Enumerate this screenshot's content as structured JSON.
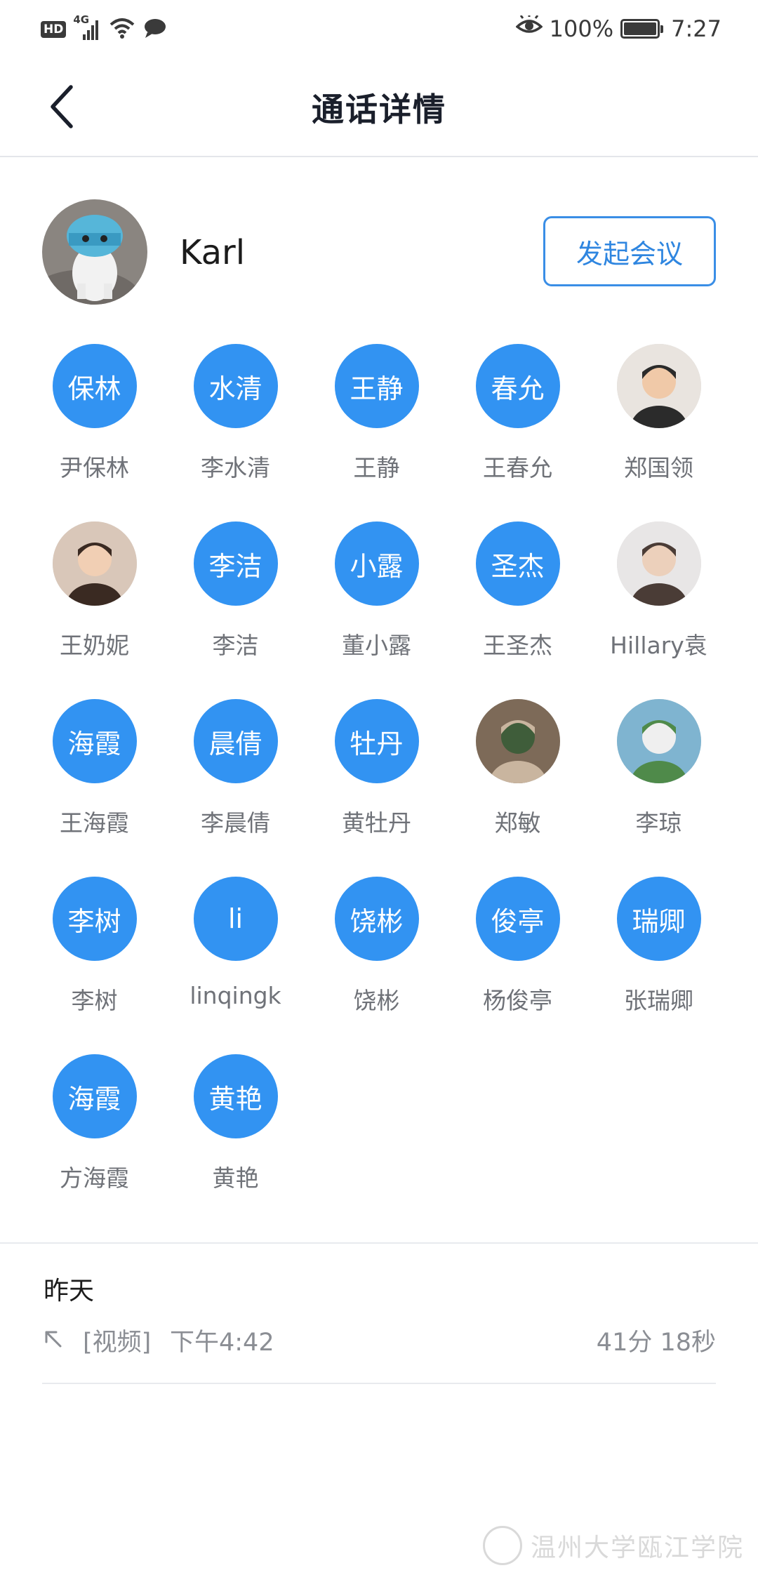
{
  "status_bar": {
    "hd": "HD",
    "network": "4G",
    "battery": "100%",
    "battery_level": 1.0,
    "time": "7:27"
  },
  "nav": {
    "title": "通话详情"
  },
  "contact": {
    "name": "Karl",
    "start_meeting_label": "发起会议"
  },
  "participants": [
    {
      "avatar_text": "保林",
      "name": "尹保林"
    },
    {
      "avatar_text": "水清",
      "name": "李水清"
    },
    {
      "avatar_text": "王静",
      "name": "王静"
    },
    {
      "avatar_text": "春允",
      "name": "王春允"
    },
    {
      "avatar_text": "",
      "name": "郑国领",
      "photo": true
    },
    {
      "avatar_text": "",
      "name": "王奶妮",
      "photo": true
    },
    {
      "avatar_text": "李洁",
      "name": "李洁"
    },
    {
      "avatar_text": "小露",
      "name": "董小露"
    },
    {
      "avatar_text": "圣杰",
      "name": "王圣杰"
    },
    {
      "avatar_text": "",
      "name": "Hillary袁",
      "photo": true
    },
    {
      "avatar_text": "海霞",
      "name": "王海霞"
    },
    {
      "avatar_text": "晨倩",
      "name": "李晨倩"
    },
    {
      "avatar_text": "牡丹",
      "name": "黄牡丹"
    },
    {
      "avatar_text": "",
      "name": "郑敏",
      "photo": true
    },
    {
      "avatar_text": "",
      "name": "李琼",
      "photo": true
    },
    {
      "avatar_text": "李树",
      "name": "李树"
    },
    {
      "avatar_text": "li",
      "name": "linqingk"
    },
    {
      "avatar_text": "饶彬",
      "name": "饶彬"
    },
    {
      "avatar_text": "俊亭",
      "name": "杨俊亭"
    },
    {
      "avatar_text": "瑞卿",
      "name": "张瑞卿"
    },
    {
      "avatar_text": "海霞",
      "name": "方海霞"
    },
    {
      "avatar_text": "黄艳",
      "name": "黄艳"
    }
  ],
  "record": {
    "day": "昨天",
    "type": "[视频]",
    "time": "下午4:42",
    "duration": "41分 18秒"
  },
  "watermark": {
    "text": "温州大学瓯江学院"
  },
  "colors": {
    "accent": "#3293f2",
    "button_border": "#3a8ee6",
    "secondary_text": "#8b8e94"
  }
}
